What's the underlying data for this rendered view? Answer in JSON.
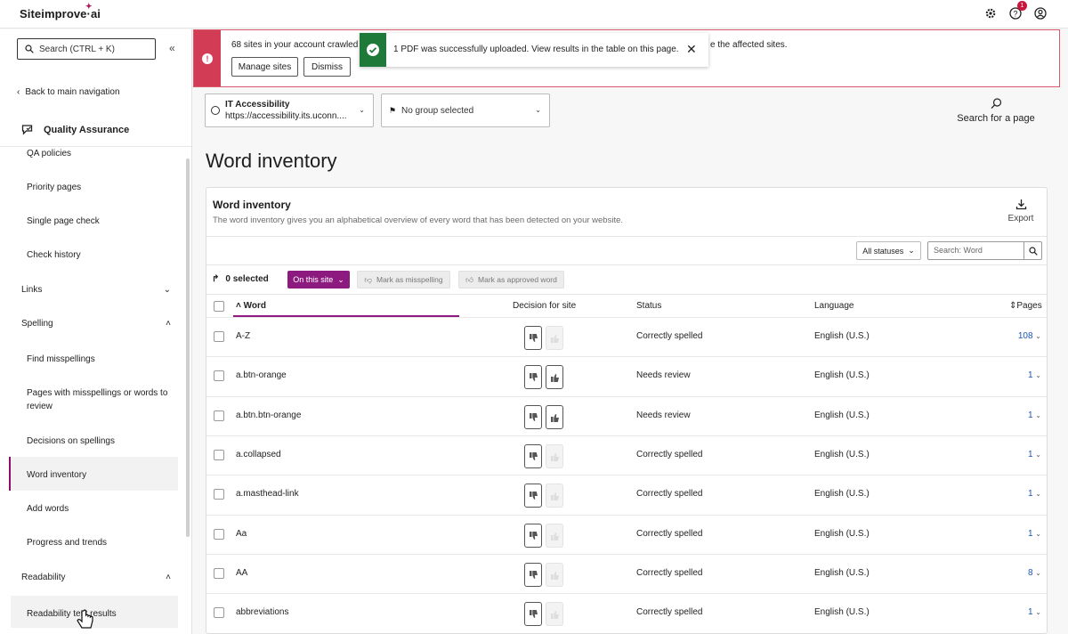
{
  "app": {
    "brand": "Siteimprove",
    "brand_suffix": "ai",
    "notifications_count": "1"
  },
  "sidebar": {
    "search_placeholder": "Search   (CTRL + K)",
    "back_label": "Back to main navigation",
    "module_title": "Quality Assurance",
    "items": [
      {
        "label": "QA policies"
      },
      {
        "label": "Priority pages"
      },
      {
        "label": "Single page check"
      },
      {
        "label": "Check history"
      }
    ],
    "sections": {
      "links": "Links",
      "spelling": "Spelling",
      "readability": "Readability"
    },
    "spelling_items": [
      {
        "label": "Find misspellings"
      },
      {
        "label": "Pages with misspellings or words to review"
      },
      {
        "label": "Decisions on spellings"
      },
      {
        "label": "Word inventory"
      },
      {
        "label": "Add words"
      },
      {
        "label": "Progress and trends"
      }
    ],
    "readability_items": [
      {
        "label": "Readability test results"
      }
    ]
  },
  "alert": {
    "text": "68 sites in your account crawled",
    "text_tail": "e the affected sites.",
    "manage_label": "Manage sites",
    "dismiss_label": "Dismiss"
  },
  "toast": {
    "text": "1 PDF was successfully uploaded. View results in the table on this page."
  },
  "site_selector": {
    "title": "IT Accessibility",
    "url": "https://accessibility.its.uconn...."
  },
  "group_selector": {
    "value": "No group selected"
  },
  "search_page_label": "Search for a page",
  "page_title": "Word inventory",
  "card": {
    "title": "Word inventory",
    "description": "The word inventory gives you an alphabetical overview of every word that has been detected on your website.",
    "export_label": "Export",
    "status_filter": "All statuses",
    "word_search_placeholder": "Search: Word",
    "selected_count": "0 selected",
    "on_site_label": "On this site",
    "mark_misspelling_label": "Mark as misspelling",
    "mark_approved_label": "Mark as approved word"
  },
  "table": {
    "columns": {
      "word": "Word",
      "decision": "Decision for site",
      "status": "Status",
      "language": "Language",
      "pages": "Pages"
    },
    "rows": [
      {
        "word": "A-Z",
        "status": "Correctly spelled",
        "language": "English (U.S.)",
        "pages": "108"
      },
      {
        "word": "a.btn-orange",
        "status": "Needs review",
        "language": "English (U.S.)",
        "pages": "1"
      },
      {
        "word": "a.btn.btn-orange",
        "status": "Needs review",
        "language": "English (U.S.)",
        "pages": "1"
      },
      {
        "word": "a.collapsed",
        "status": "Correctly spelled",
        "language": "English (U.S.)",
        "pages": "1"
      },
      {
        "word": "a.masthead-link",
        "status": "Correctly spelled",
        "language": "English (U.S.)",
        "pages": "1"
      },
      {
        "word": "Aa",
        "status": "Correctly spelled",
        "language": "English (U.S.)",
        "pages": "1"
      },
      {
        "word": "AA",
        "status": "Correctly spelled",
        "language": "English (U.S.)",
        "pages": "8"
      },
      {
        "word": "abbreviations",
        "status": "Correctly spelled",
        "language": "English (U.S.)",
        "pages": "1"
      }
    ]
  },
  "colors": {
    "accent": "#8c1a7f",
    "alert": "#d23c55",
    "success": "#1f7a3a",
    "link": "#1a56b9"
  }
}
